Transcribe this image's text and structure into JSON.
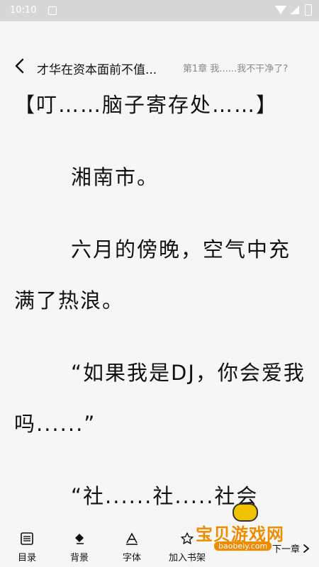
{
  "status_bar": {
    "time": "10:10"
  },
  "header": {
    "book_title": "才华在资本面前不值...",
    "chapter_title": "第1章 我......我不干净了?"
  },
  "content": {
    "paragraphs": [
      "【叮……脑子寄存处……】",
      "湘南市。",
      "六月的傍晚，空气中充满了热浪。",
      "“如果我是DJ，你会爱我吗......”",
      "“社......社.....社会"
    ]
  },
  "watermark": {
    "brand": "宝贝游戏网",
    "url": "baobeiy.com"
  },
  "toolbar": {
    "toc_label": "目录",
    "background_label": "背景",
    "font_label": "字体",
    "add_shelf_label": "加入书架",
    "next_label": "下一章"
  }
}
